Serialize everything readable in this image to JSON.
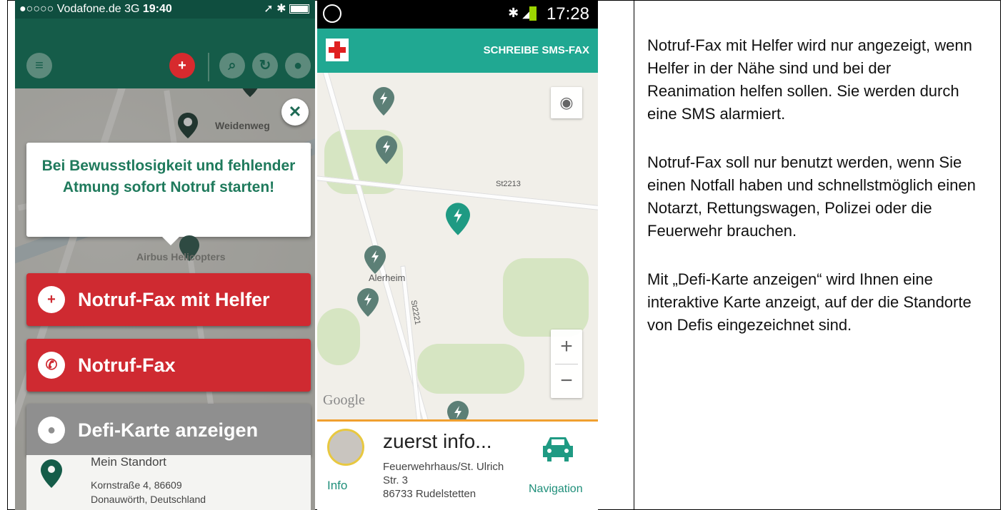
{
  "phone1": {
    "status": {
      "carrier": "●○○○○ Vodafone.de  3G",
      "time": "19:40"
    },
    "nav_icons": [
      "menu-icon",
      "sms-add-icon",
      "search-location-icon",
      "refresh-icon",
      "user-icon"
    ],
    "close_glyph": "✕",
    "warning": "Bei Bewusstlosigkeit und fehlender Atmung sofort Notruf starten!",
    "map_labels": {
      "weidenweg": "Weidenweg",
      "airbus": "Airbus Helicopters"
    },
    "buttons": [
      {
        "label": "Notruf-Fax mit Helfer",
        "icon": "add-person-icon",
        "color": "#cf2a31"
      },
      {
        "label": "Notruf-Fax",
        "icon": "phone-add-icon",
        "color": "#cf2a31"
      },
      {
        "label": "Defi-Karte anzeigen",
        "icon": "map-pin-icon",
        "color": "#8f8f8f"
      }
    ],
    "location": {
      "title": "Mein Standort",
      "line1": "Kornstraße 4, 86609",
      "line2": "Donauwörth, Deutschland"
    }
  },
  "phone2": {
    "status": {
      "time": "17:28"
    },
    "appbar": {
      "action": "SCHREIBE SMS-FAX"
    },
    "map_labels": {
      "st2213": "St2213",
      "st2221": "St2221",
      "town": "Alerheim",
      "google": "Google"
    },
    "zoom": {
      "plus": "+",
      "minus": "−"
    },
    "info": {
      "title": "zuerst info...",
      "addr1": "Feuerwehrhaus/St. Ulrich",
      "addr2": "Str. 3",
      "addr3": "86733 Rudelstetten",
      "info_label": "Info",
      "nav_label": "Navigation"
    },
    "accent": "#20a892"
  },
  "description": {
    "p1": "Notruf-Fax mit Helfer wird nur angezeigt, wenn Helfer in der Nähe sind und bei der Reanimation helfen sollen. Sie werden durch eine SMS alarmiert.",
    "p2": "Notruf-Fax soll nur benutzt werden, wenn Sie einen Notfall haben und schnellstmöglich einen Notarzt, Rettungswagen, Polizei oder die Feuerwehr brauchen.",
    "p3": "Mit „Defi-Karte anzeigen“ wird Ihnen eine interaktive Karte anzeigt, auf der die Standorte von Defis eingezeichnet sind."
  }
}
